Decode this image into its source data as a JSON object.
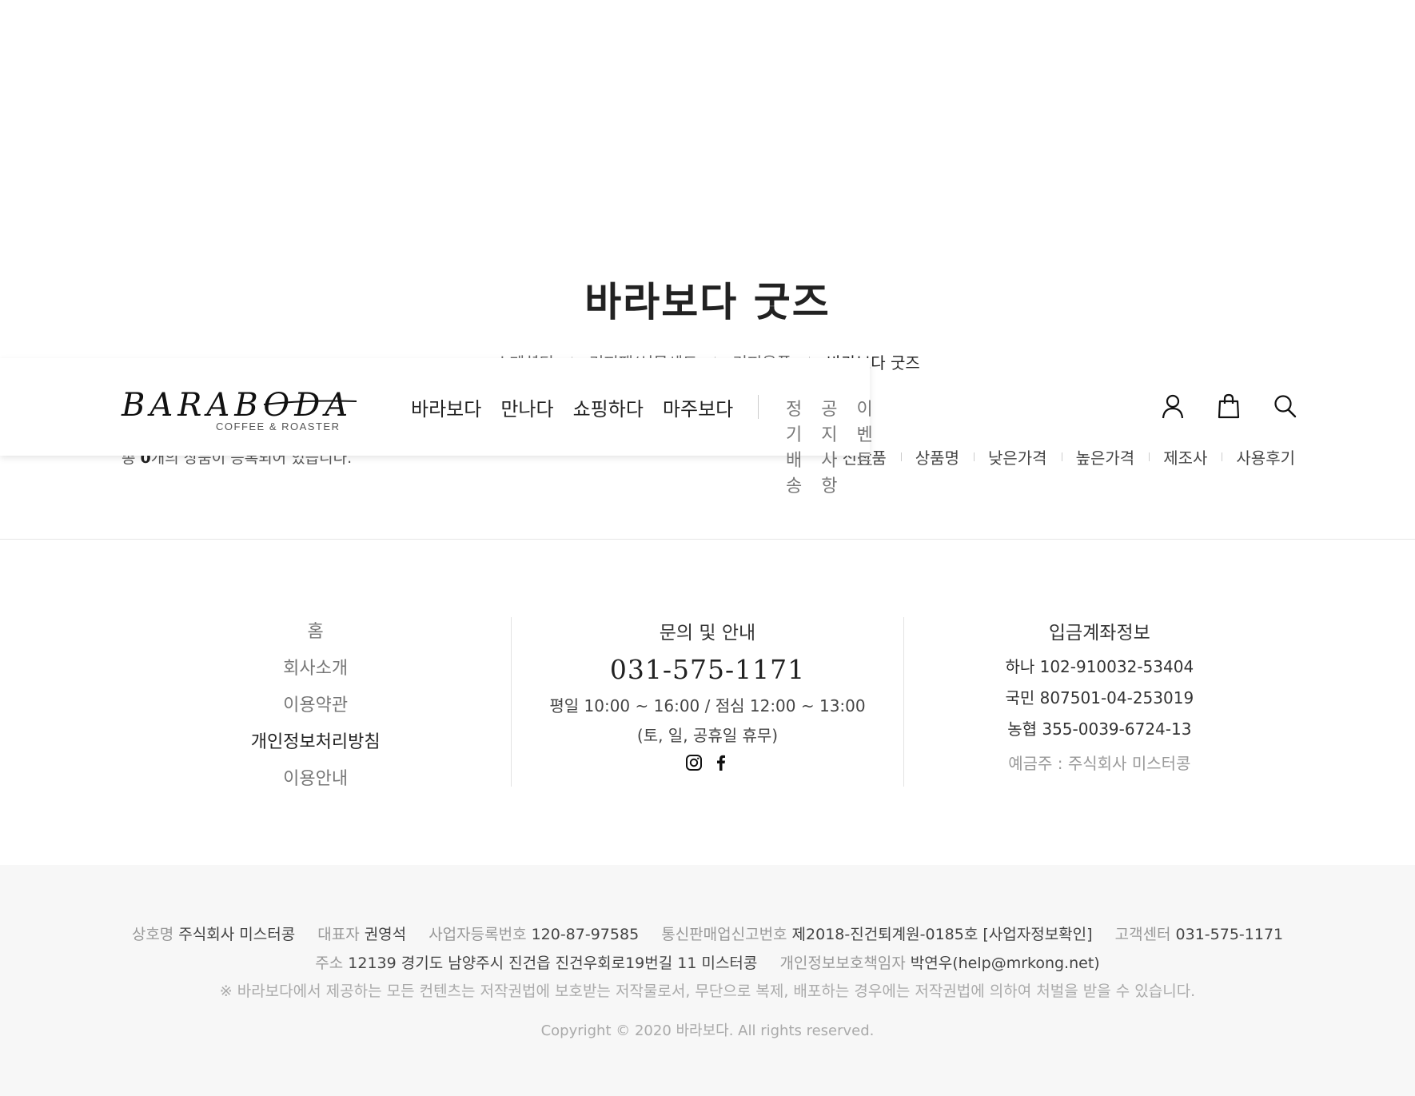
{
  "page": {
    "title": "바라보다 굿즈"
  },
  "category_tabs": [
    {
      "label": "스페셜티"
    },
    {
      "label": "커피팩/선물세트"
    },
    {
      "label": "커피용품"
    },
    {
      "label": "바라보다 굿즈"
    }
  ],
  "listing": {
    "count_prefix": "총 ",
    "count": "0",
    "count_suffix": "개의 상품이 등록되어 있습니다."
  },
  "sort_options": [
    "신상품",
    "상품명",
    "낮은가격",
    "높은가격",
    "제조사",
    "사용후기"
  ],
  "header": {
    "logo_text": "BARABODA",
    "logo_sub": "COFFEE & ROASTER",
    "main_nav": [
      "바라보다",
      "만나다",
      "쇼핑하다",
      "마주보다"
    ],
    "sub_nav": [
      "정기배송",
      "공지사항",
      "이벤트"
    ],
    "icons": [
      "user-icon",
      "shopping-bag-icon",
      "search-icon"
    ]
  },
  "footer": {
    "links": [
      "홈",
      "회사소개",
      "이용약관",
      "개인정보처리방침",
      "이용안내"
    ],
    "contact": {
      "title": "문의 및 안내",
      "phone": "031-575-1171",
      "hours": "평일 10:00 ~ 16:00 / 점심 12:00 ~ 13:00",
      "closed": "(토, 일, 공휴일 휴무)"
    },
    "bank": {
      "title": "입금계좌정보",
      "accounts": [
        "하나 102-910032-53404",
        "국민 807501-04-253019",
        "농협 355-0039-6724-13"
      ],
      "holder": "예금주 : 주식회사 미스터콩"
    },
    "company": {
      "name_label": "상호명",
      "name": "주식회사 미스터콩",
      "ceo_label": "대표자",
      "ceo": "권영석",
      "biz_label": "사업자등록번호",
      "biz": "120-87-97585",
      "mail_label": "통신판매업신고번호",
      "mail": "제2018-진건퇴계원-0185호 [사업자정보확인]",
      "cs_label": "고객센터",
      "cs": "031-575-1171",
      "addr_label": "주소",
      "addr": "12139 경기도 남양주시 진건읍 진건우회로19번길 11 미스터콩",
      "privacy_label": "개인정보보호책임자",
      "privacy": "박연우(help@mrkong.net)",
      "notice": "※ 바라보다에서 제공하는 모든 컨텐츠는 저작권법에 보호받는 저작물로서, 무단으로 복제, 배포하는 경우에는 저작권법에 의하여 처벌을 받을 수 있습니다.",
      "copyright": "Copyright © 2020 바라보다. All rights reserved."
    }
  }
}
